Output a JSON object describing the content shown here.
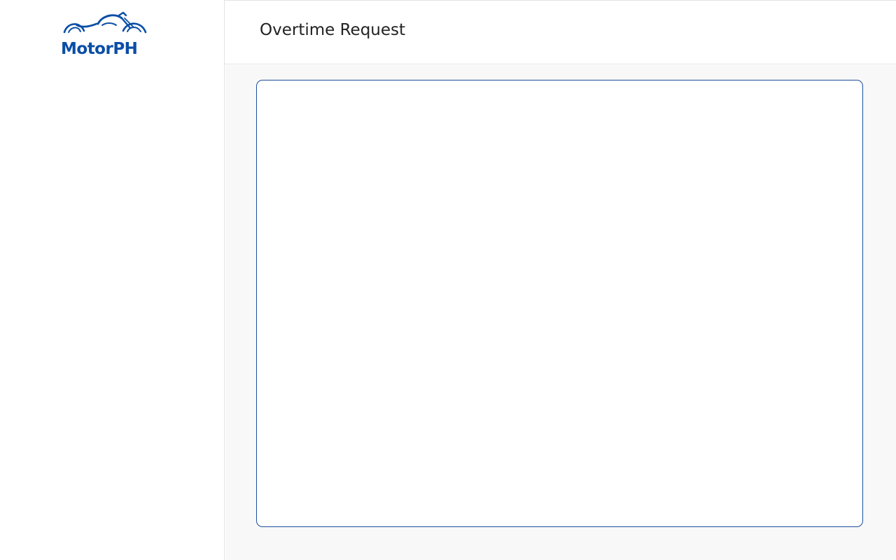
{
  "brand": {
    "name": "MotorPH",
    "logo_icon": "motorcycle-icon",
    "color": "#0a4ea6"
  },
  "header": {
    "title": "Overtime Request"
  },
  "main": {
    "panel_border_color": "#1b4f9c"
  }
}
